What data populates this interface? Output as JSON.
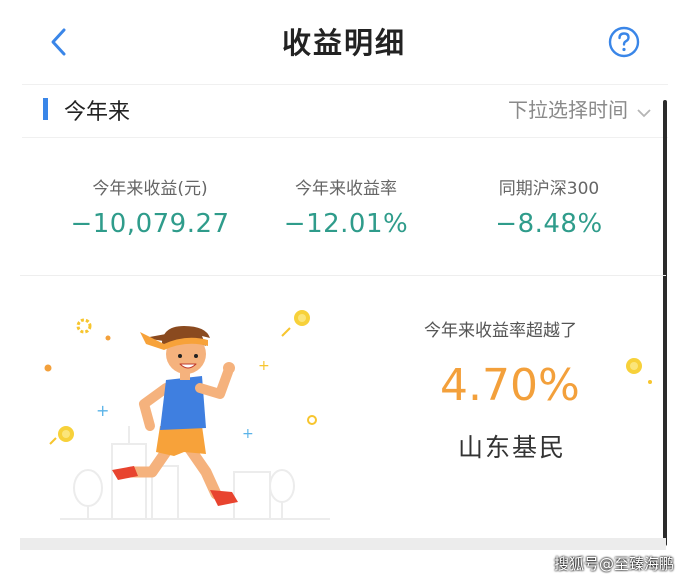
{
  "nav": {
    "title": "收益明细",
    "back_icon": "chevron-left-icon",
    "help_icon": "help-circle-icon"
  },
  "section": {
    "period_label": "今年来",
    "time_picker_label": "下拉选择时间"
  },
  "stats": [
    {
      "label": "今年来收益(元)",
      "value": "−10,079.27"
    },
    {
      "label": "今年来收益率",
      "value": "−12.01%"
    },
    {
      "label": "同期沪深300",
      "value": "−8.48%"
    }
  ],
  "hero": {
    "beat_label": "今年来收益率超越了",
    "beat_value": "4.70%",
    "beat_region": "山东基民"
  },
  "watermark": "搜狐号@至臻海鹏",
  "colors": {
    "accent": "#3a86e8",
    "negative": "#2f9c8b",
    "highlight": "#f3a03b"
  }
}
